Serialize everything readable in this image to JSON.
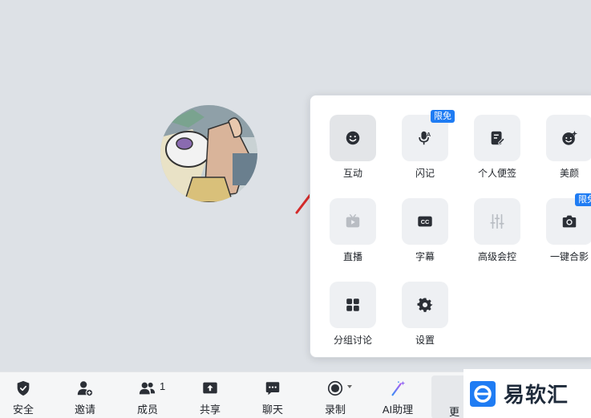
{
  "panel": {
    "items": [
      {
        "label": "互动",
        "icon": "smile-icon"
      },
      {
        "label": "闪记",
        "icon": "mic-icon",
        "badge": "限免"
      },
      {
        "label": "个人便签",
        "icon": "note-icon"
      },
      {
        "label": "美颜",
        "icon": "sparkle-face-icon"
      },
      {
        "label": "直播",
        "icon": "tv-icon"
      },
      {
        "label": "字幕",
        "icon": "cc-icon"
      },
      {
        "label": "高级会控",
        "icon": "sliders-icon"
      },
      {
        "label": "一键合影",
        "icon": "camera-icon",
        "badge": "限免"
      },
      {
        "label": "分组讨论",
        "icon": "grid-icon"
      },
      {
        "label": "设置",
        "icon": "gear-icon"
      }
    ]
  },
  "toolbar": {
    "items": [
      {
        "label": "安全",
        "icon": "shield-icon"
      },
      {
        "label": "邀请",
        "icon": "add-user-icon"
      },
      {
        "label": "成员",
        "icon": "members-icon",
        "count": "1"
      },
      {
        "label": "共享",
        "icon": "share-icon"
      },
      {
        "label": "聊天",
        "icon": "chat-icon"
      },
      {
        "label": "录制",
        "icon": "record-icon"
      },
      {
        "label": "AI助理",
        "icon": "ai-wand-icon"
      }
    ],
    "more_label": "更"
  },
  "watermark": {
    "text": "易软汇"
  },
  "colors": {
    "accent": "#1f7cf3",
    "icon": "#2b2f36",
    "background": "#dde1e6"
  }
}
